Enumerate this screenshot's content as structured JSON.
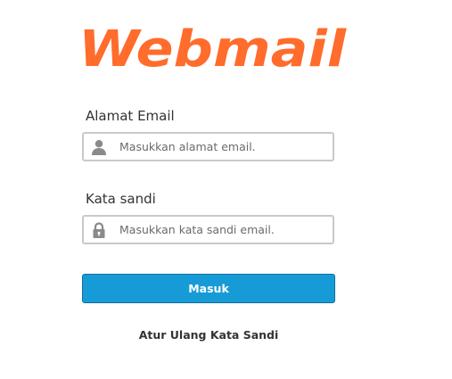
{
  "logo": {
    "text": "Webmail",
    "color": "#ff6c2c"
  },
  "form": {
    "email": {
      "label": "Alamat Email",
      "placeholder": "Masukkan alamat email.",
      "value": "",
      "icon": "user-icon"
    },
    "password": {
      "label": "Kata sandi",
      "placeholder": "Masukkan kata sandi email.",
      "value": "",
      "icon": "lock-icon"
    },
    "submit_label": "Masuk",
    "reset_label": "Atur Ulang Kata Sandi"
  },
  "colors": {
    "button": "#179bd7",
    "field_border": "#c9c9c9",
    "icon": "#8a8a8a"
  }
}
